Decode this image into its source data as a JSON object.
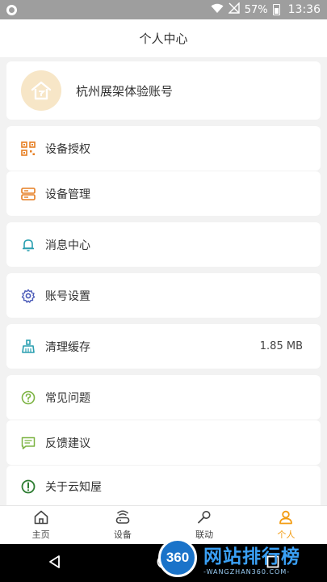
{
  "status_bar": {
    "battery": "57%",
    "time": "13:36"
  },
  "header": {
    "title": "个人中心"
  },
  "profile": {
    "name": "杭州展架体验账号"
  },
  "menu": [
    {
      "label": "设备授权",
      "icon": "qr-code-icon"
    },
    {
      "label": "设备管理",
      "icon": "server-icon"
    },
    {
      "label": "消息中心",
      "icon": "bell-icon"
    },
    {
      "label": "账号设置",
      "icon": "gear-icon"
    },
    {
      "label": "清理缓存",
      "icon": "broom-icon",
      "value": "1.85 MB"
    },
    {
      "label": "常见问题",
      "icon": "question-icon"
    },
    {
      "label": "反馈建议",
      "icon": "feedback-icon"
    },
    {
      "label": "关于云知屋",
      "icon": "info-icon"
    }
  ],
  "tabs": [
    {
      "label": "主页",
      "icon": "home-icon"
    },
    {
      "label": "设备",
      "icon": "router-icon"
    },
    {
      "label": "联动",
      "icon": "link-icon"
    },
    {
      "label": "个人",
      "icon": "person-icon",
      "active": true
    }
  ],
  "watermark": {
    "badge": "360",
    "title": "网站排行榜",
    "subtitle": "-WANGZHAN360.COM-"
  },
  "colors": {
    "accent": "#f39c12",
    "icon_orange": "#e67e22",
    "icon_teal": "#2a9fb0",
    "icon_indigo": "#4a5ab8",
    "icon_green": "#7cb342"
  }
}
